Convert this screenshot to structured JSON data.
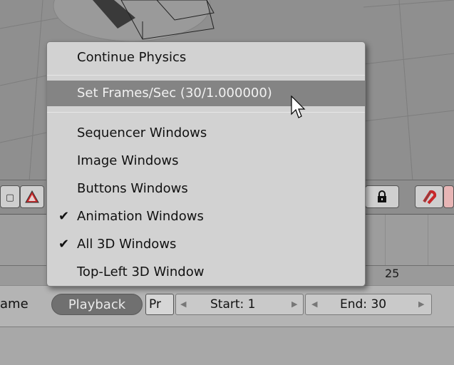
{
  "popup_menu": {
    "items": [
      {
        "label": "Continue Physics",
        "checked": false,
        "highlighted": false
      },
      {
        "label": "Set Frames/Sec (30/1.000000)",
        "checked": false,
        "highlighted": true
      },
      {
        "label": "Sequencer Windows",
        "checked": false,
        "highlighted": false
      },
      {
        "label": "Image Windows",
        "checked": false,
        "highlighted": false
      },
      {
        "label": "Buttons Windows",
        "checked": false,
        "highlighted": false
      },
      {
        "label": "Animation Windows",
        "checked": true,
        "highlighted": false
      },
      {
        "label": "All 3D Windows",
        "checked": true,
        "highlighted": false
      },
      {
        "label": "Top-Left 3D Window",
        "checked": false,
        "highlighted": false
      }
    ],
    "check_glyph": "✔"
  },
  "timeline": {
    "frame_marker": "25"
  },
  "controls": {
    "frame_label_partial": "ame",
    "playback_label": "Playback",
    "pr_label": "Pr",
    "start_label": "Start: 1",
    "end_label": "End: 30"
  },
  "header_icons": {
    "warning_icon": "warning-triangle-icon",
    "lock_icon": "lock-icon",
    "magnet_icon": "magnet-icon"
  },
  "colors": {
    "menu_bg": "#d2d2d2",
    "menu_highlight": "#848484",
    "viewport_bg": "#8f8f8f",
    "warning_red": "#c8282a"
  }
}
